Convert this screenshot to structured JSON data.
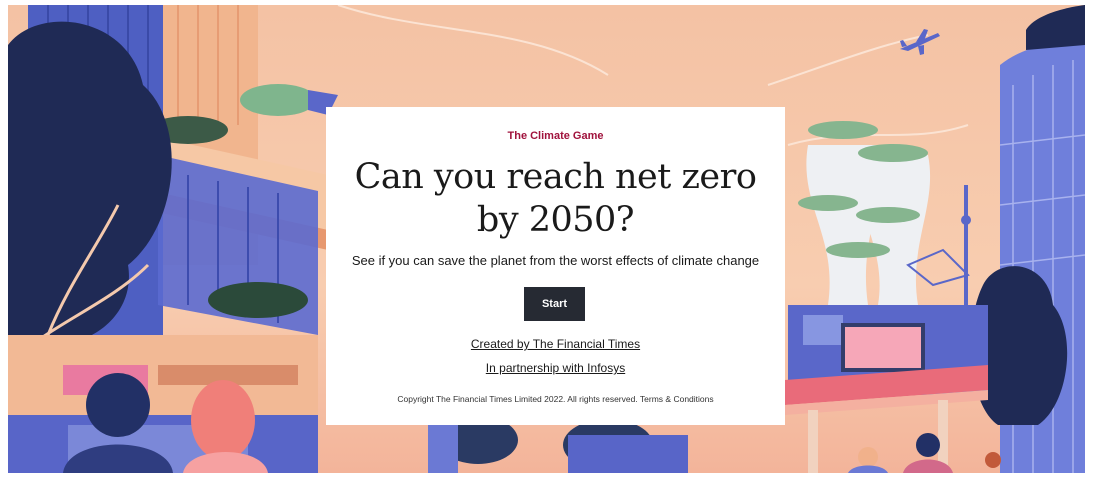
{
  "game": {
    "eyebrow": "The Climate Game",
    "headline_line1": "Can you reach net zero",
    "headline_line2": "by 2050?",
    "subtitle": "See if you can save the planet from the worst effects of climate change",
    "start_label": "Start",
    "created_by": "Created by The Financial Times",
    "partnership": "In partnership with Infosys",
    "copyright": "Copyright The Financial Times Limited 2022. All rights reserved.",
    "terms": "Terms & Conditions"
  },
  "colors": {
    "eyebrow": "#a0123c",
    "button": "#262a33",
    "sky": "#f7c6a6",
    "building_blue": "#5a67c9",
    "dark_navy": "#1f2a52"
  },
  "icons": [
    "airplane-icon"
  ]
}
